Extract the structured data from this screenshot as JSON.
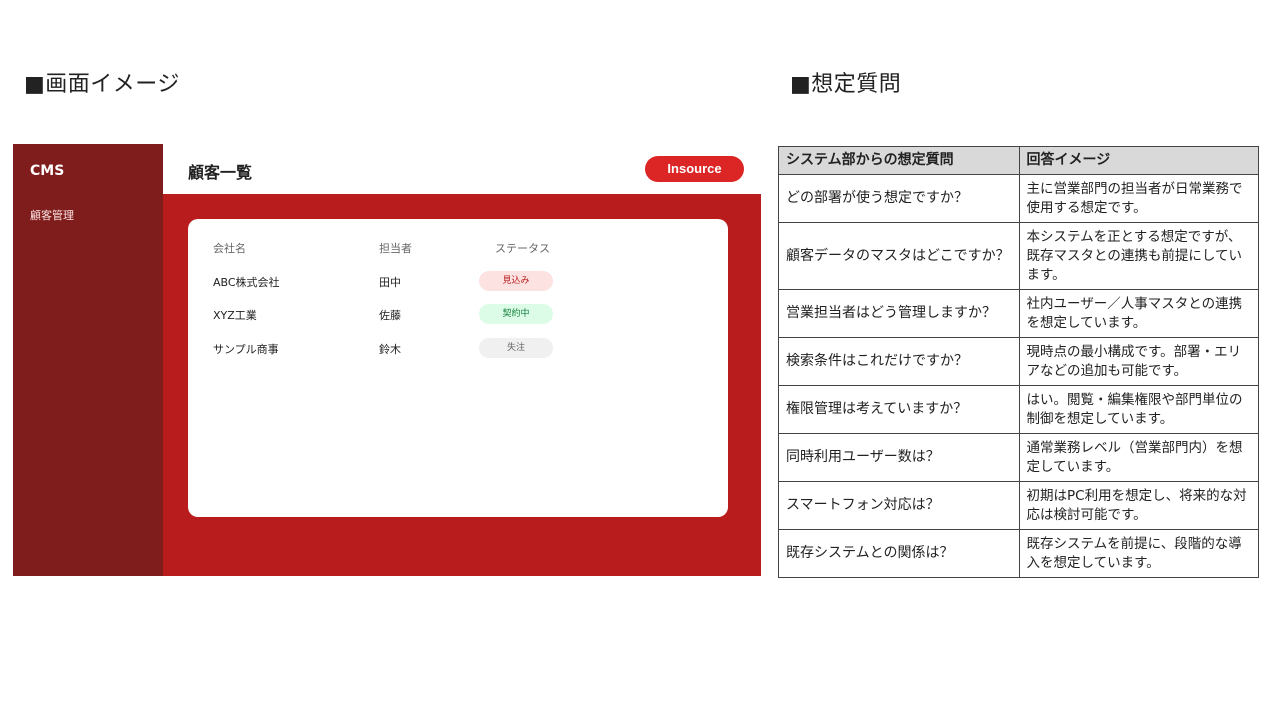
{
  "headings": {
    "left": "■画面イメージ",
    "right": "■想定質問"
  },
  "mockup": {
    "brand": "CMS",
    "nav_item": "顧客管理",
    "title": "顧客一覧",
    "logo": "Insource",
    "columns": [
      "会社名",
      "担当者",
      "ステータス"
    ],
    "rows": [
      {
        "company": "ABC株式会社",
        "person": "田中",
        "status": "見込み"
      },
      {
        "company": "XYZ工業",
        "person": "佐藤",
        "status": "契約中"
      },
      {
        "company": "サンプル商事",
        "person": "鈴木",
        "status": "失注"
      }
    ],
    "colors": {
      "sidebar": "#7f1d1d",
      "main": "#b91c1c",
      "accent": "#dc2626"
    }
  },
  "faq": {
    "headers": [
      "システム部からの想定質問",
      "回答イメージ"
    ],
    "rows": [
      {
        "q": "どの部署が使う想定ですか？",
        "a": "主に営業部門の担当者が日常業務で使用する想定です。"
      },
      {
        "q": "顧客データのマスタはどこですか？",
        "a": "本システムを正とする想定ですが、既存マスタとの連携も前提にしています。"
      },
      {
        "q": "営業担当者はどう管理しますか？",
        "a": "社内ユーザー／人事マスタとの連携を想定しています。"
      },
      {
        "q": "検索条件はこれだけですか？",
        "a": "現時点の最小構成です。部署・エリアなどの追加も可能です。"
      },
      {
        "q": "権限管理は考えていますか？",
        "a": "はい。閲覧・編集権限や部門単位の制御を想定しています。"
      },
      {
        "q": "同時利用ユーザー数は？",
        "a": "通常業務レベル（営業部門内）を想定しています。"
      },
      {
        "q": "スマートフォン対応は？",
        "a": "初期はPC利用を想定し、将来的な対応は検討可能です。"
      },
      {
        "q": "既存システムとの関係は？",
        "a": "既存システムを前提に、段階的な導入を想定しています。"
      }
    ]
  }
}
